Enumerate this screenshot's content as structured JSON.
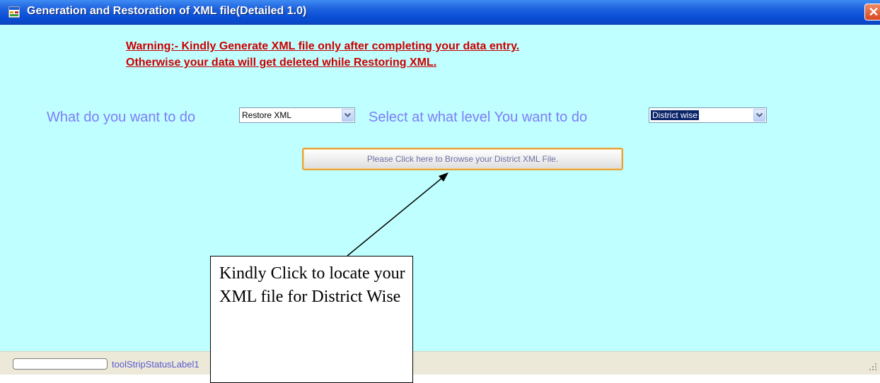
{
  "window": {
    "title": "Generation and Restoration of XML file(Detailed 1.0)",
    "close_symbol": "✕"
  },
  "warning": {
    "line1": "Warning:- Kindly Generate XML file only after completing your data entry.",
    "line2": "Otherwise your data will get deleted while Restoring XML."
  },
  "form": {
    "action_label": "What do you want to do",
    "action_value": "Restore XML",
    "level_label": "Select at what level You want to do",
    "level_value": "District wise",
    "browse_button": "Please Click here to Browse your District XML File."
  },
  "statusbar": {
    "label": "toolStripStatusLabel1"
  },
  "callout": {
    "text": "Kindly Click to locate your XML file for District Wise"
  },
  "colors": {
    "background": "#c0ffff",
    "warning": "#cc0000",
    "label": "#7d7dfa"
  },
  "icons": [
    "app-icon",
    "close-icon",
    "dropdown-arrow-icon",
    "resize-grip-icon"
  ]
}
